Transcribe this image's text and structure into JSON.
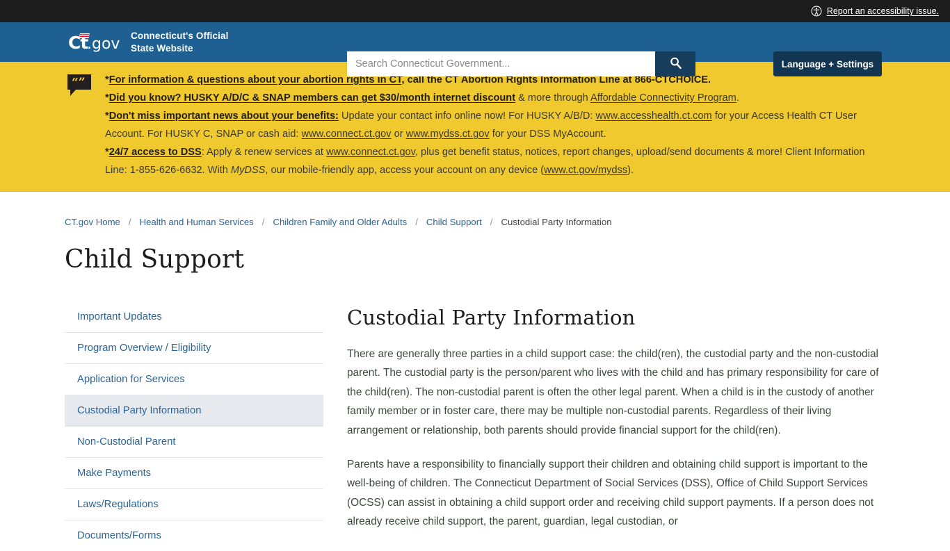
{
  "utility_bar": {
    "accessibility_link": "Report an accessibility issue.",
    "accessibility_icon": "accessibility-person-icon"
  },
  "header": {
    "logo_text": "Ct.gov",
    "brand_line1": "Connecticut's Official",
    "brand_line2": "State Website",
    "search_placeholder": "Search Connecticut Government...",
    "search_value": "",
    "search_icon": "search-icon",
    "language_settings_label": "Language + Settings",
    "colors": {
      "header_blue": "#1f6093",
      "button_navy": "#123652",
      "utility_black": "#1d1d1d"
    }
  },
  "alert_banner": {
    "icon": "speech-bubble-quote-icon",
    "background_color": "#f0c92f",
    "lines": [
      {
        "segments": [
          {
            "text": "*",
            "bold": true
          },
          {
            "text": "For information & questions about your abortion rights in CT",
            "bold": true,
            "link": true
          },
          {
            "text": ", call the CT Abortion Rights Information Line at 866-CTCHOICE.",
            "bold": true
          }
        ]
      },
      {
        "segments": [
          {
            "text": "*",
            "bold": true
          },
          {
            "text": "Did you know? HUSKY A/D/C & SNAP members can get $30/month internet discount",
            "bold": true,
            "link": true
          },
          {
            "text": " & more through "
          },
          {
            "text": "Affordable Connectivity Program",
            "link": true
          },
          {
            "text": "."
          }
        ]
      },
      {
        "segments": [
          {
            "text": "*",
            "bold": true
          },
          {
            "text": "Don't miss important news about your benefits:",
            "bold": true,
            "link": true
          },
          {
            "text": " Update your contact info online now! For HUSKY A/B/D: "
          },
          {
            "text": "www.accesshealth.ct.com",
            "link": true
          },
          {
            "text": " for your Access Health CT User Account. For HUSKY C, SNAP or cash aid: "
          },
          {
            "text": "www.connect.ct.gov",
            "link": true
          },
          {
            "text": " or "
          },
          {
            "text": "www.mydss.ct.gov",
            "link": true
          },
          {
            "text": " for your DSS MyAccount."
          }
        ]
      },
      {
        "segments": [
          {
            "text": "*",
            "bold": true
          },
          {
            "text": "24/7 access to DSS",
            "bold": true,
            "link": true
          },
          {
            "text": ": Apply & renew services at "
          },
          {
            "text": "www.connect.ct.gov",
            "link": true
          },
          {
            "text": ", plus get benefit status, notices, report changes, upload/send documents & more! Client Information Line: 1-855-626-6632. With "
          },
          {
            "text": "MyDSS",
            "italic": true
          },
          {
            "text": ", our mobile-friendly app, access your account on any device ("
          },
          {
            "text": "www.ct.gov/mydss",
            "link": true
          },
          {
            "text": ")."
          }
        ]
      }
    ]
  },
  "breadcrumb": {
    "items": [
      {
        "label": "CT.gov Home",
        "link": true
      },
      {
        "label": "Health and Human Services",
        "link": true
      },
      {
        "label": "Children Family and Older Adults",
        "link": true
      },
      {
        "label": "Child Support",
        "link": true
      },
      {
        "label": "Custodial Party Information",
        "link": false
      }
    ],
    "separator": "/"
  },
  "page_title": "Child Support",
  "sidebar": {
    "items": [
      {
        "label": "Important Updates",
        "active": false
      },
      {
        "label": "Program Overview / Eligibility",
        "active": false
      },
      {
        "label": "Application for Services",
        "active": false
      },
      {
        "label": "Custodial Party Information",
        "active": true
      },
      {
        "label": "Non-Custodial Parent",
        "active": false
      },
      {
        "label": "Make Payments",
        "active": false
      },
      {
        "label": "Laws/Regulations",
        "active": false
      },
      {
        "label": "Documents/Forms",
        "active": false
      }
    ],
    "active_background": "#e6e9ed",
    "link_color": "#2a6496"
  },
  "main": {
    "heading": "Custodial Party Information",
    "paragraphs": [
      "There are generally three parties in a child support case: the child(ren), the custodial party and the non-custodial parent. The custodial party is the person/parent who lives with the child and has primary responsibility for care of the child(ren).  The non-custodial parent is often the other legal parent. When a child is in the custody of another family member or in foster care, there may be multiple non-custodial parents.  Regardless of their living arrangement or relationship, both parents should provide financial support for the child(ren).",
      "Parents have a responsibility to financially support their children and obtaining child support is important to the well-being of children. The Connecticut Department of Social Services (DSS), Office of Child Support Services (OCSS) can assist in obtaining a child support order and receiving child support payments. If a person does not already receive child support, the parent, guardian, legal custodian, or"
    ]
  }
}
